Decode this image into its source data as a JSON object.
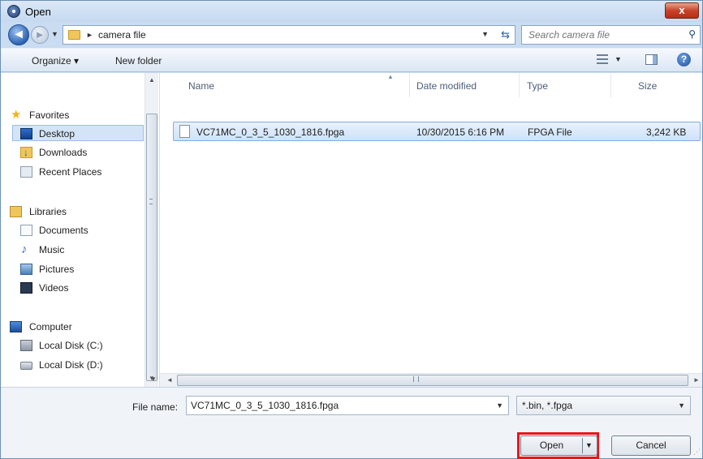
{
  "window": {
    "title": "Open",
    "close_symbol": "x",
    "accent_color": "#c7442a"
  },
  "nav": {
    "back_symbol": "◄",
    "forward_symbol": "►",
    "breadcrumb": "camera file",
    "search_placeholder": "Search camera file"
  },
  "toolbar": {
    "organize_label": "Organize ▾",
    "new_folder_label": "New folder",
    "help_symbol": "?"
  },
  "sidebar": {
    "favorites_label": "Favorites",
    "desktop_label": "Desktop",
    "downloads_label": "Downloads",
    "recent_label": "Recent Places",
    "libraries_label": "Libraries",
    "documents_label": "Documents",
    "music_label": "Music",
    "pictures_label": "Pictures",
    "videos_label": "Videos",
    "computer_label": "Computer",
    "disk_c_label": "Local Disk (C:)",
    "disk_d_label": "Local Disk (D:)"
  },
  "files": {
    "columns": {
      "name": "Name",
      "date": "Date modified",
      "type": "Type",
      "size": "Size"
    },
    "rows": [
      {
        "name": "VC71MC_0_3_5_1030_1816.fpga",
        "date": "10/30/2015 6:16 PM",
        "type": "FPGA File",
        "size": "3,242 KB"
      }
    ]
  },
  "footer": {
    "file_name_label": "File name:",
    "file_name_value": "VC71MC_0_3_5_1030_1816.fpga",
    "file_type_value": "*.bin, *.fpga",
    "open_label": "Open",
    "cancel_label": "Cancel",
    "highlight_color": "#e8151a"
  }
}
